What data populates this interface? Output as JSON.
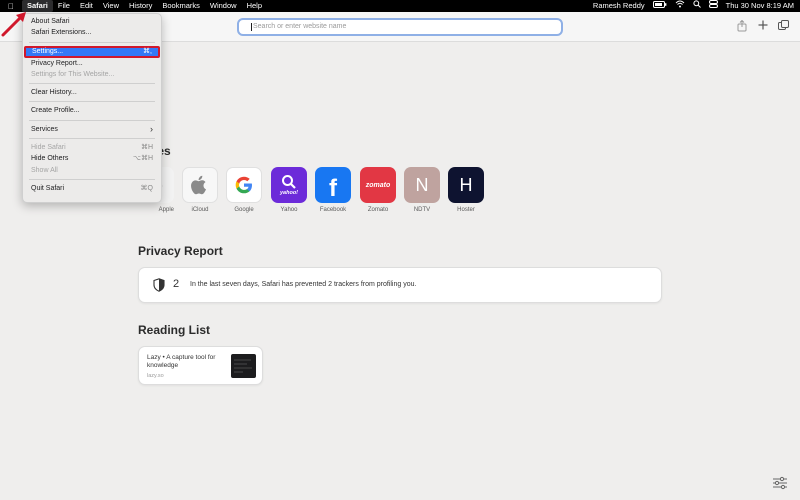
{
  "menubar": {
    "apple_icon": "apple-icon",
    "items": [
      "Safari",
      "File",
      "Edit",
      "View",
      "History",
      "Bookmarks",
      "Window",
      "Help"
    ],
    "user": "Ramesh Reddy",
    "datetime": "Thu 30 Nov  8:19 AM"
  },
  "toolbar": {
    "search_placeholder": "Search or enter website name"
  },
  "safari_menu": {
    "about": "About Safari",
    "extensions": "Safari Extensions...",
    "settings": "Settings...",
    "settings_shortcut": "⌘,",
    "privacy_report": "Privacy Report...",
    "settings_for_website": "Settings for This Website...",
    "clear_history": "Clear History...",
    "create_profile": "Create Profile...",
    "services": "Services",
    "services_arrow": "›",
    "hide_safari": "Hide Safari",
    "hide_safari_shortcut": "⌘H",
    "hide_others": "Hide Others",
    "hide_others_shortcut": "⌥⌘H",
    "show_all": "Show All",
    "quit": "Quit Safari",
    "quit_shortcut": "⌘Q"
  },
  "favourites": {
    "title": "Favourites",
    "title_visible": "urites",
    "items": [
      {
        "label": "Apple",
        "color": "#f2f2f2"
      },
      {
        "label": "iCloud",
        "glyph": "",
        "color": "#d9d9d9"
      },
      {
        "label": "Google",
        "glyph": "G",
        "color": "#ffffff"
      },
      {
        "label": "Yahoo",
        "glyph": "yahoo!",
        "color": "#6c2bd9"
      },
      {
        "label": "Facebook",
        "glyph": "f",
        "color": "#1877f2"
      },
      {
        "label": "Zomato",
        "glyph": "zomato",
        "color": "#e23744"
      },
      {
        "label": "NDTV",
        "glyph": "N",
        "color": "#bfa39f"
      },
      {
        "label": "Hoster",
        "glyph": "H",
        "color": "#0e1330"
      }
    ]
  },
  "privacy": {
    "title": "Privacy Report",
    "count": "2",
    "text": "In the last seven days, Safari has prevented 2 trackers from profiling you."
  },
  "reading_list": {
    "title": "Reading List",
    "item_title": "Lazy • A capture tool for knowledge",
    "item_host": "lazy.so"
  },
  "colors": {
    "accent": "#3478f6",
    "highlight_border": "#d0182c"
  }
}
